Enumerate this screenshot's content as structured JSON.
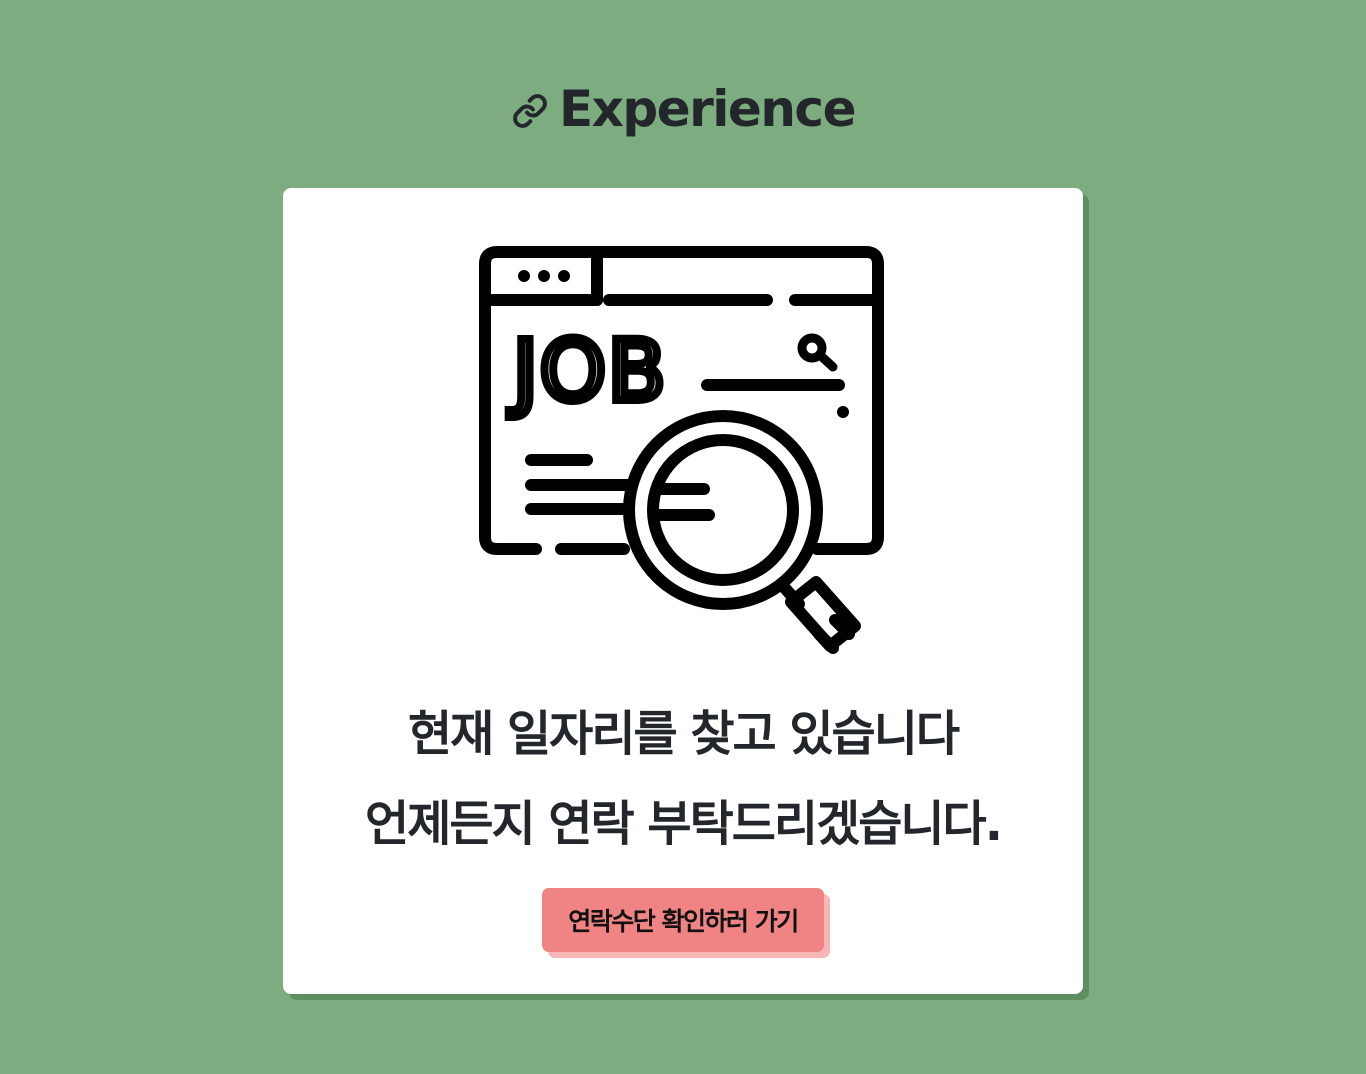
{
  "section": {
    "title": "Experience",
    "title_icon": "link-icon"
  },
  "card": {
    "illustration": {
      "icon": "job-search-browser-icon",
      "text": "JOB"
    },
    "message_line1": "현재 일자리를 찾고 있습니다",
    "message_line2": "언제든지 연락 부탁드리겠습니다.",
    "contact_button_label": "연락수단 확인하러 가기"
  },
  "colors": {
    "background": "#7dac80",
    "card": "#ffffff",
    "button": "#f08383",
    "button_shadow": "#f7b7b7",
    "text": "#23262b"
  }
}
